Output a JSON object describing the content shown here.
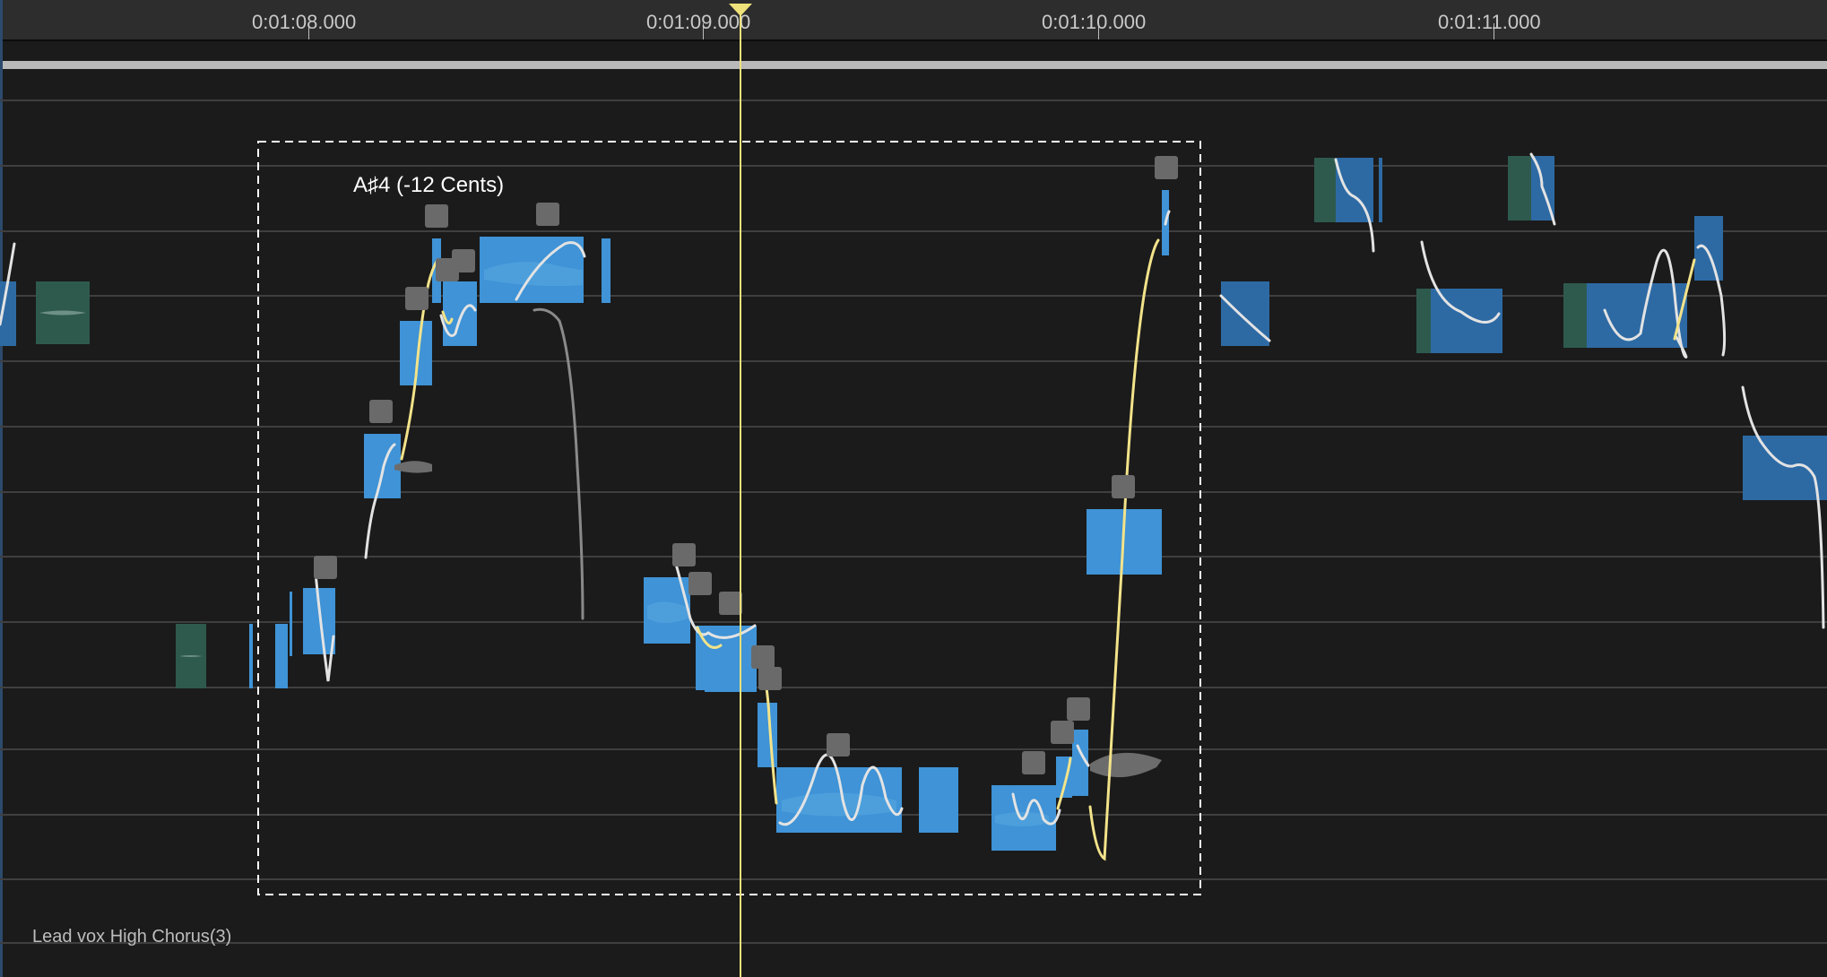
{
  "ruler": {
    "ticks": [
      {
        "label": "0:01:08.000",
        "time": 68.0
      },
      {
        "label": "0:01:09.000",
        "time": 69.0
      },
      {
        "label": "0:01:10.000",
        "time": 70.0
      },
      {
        "label": "0:01:11.000",
        "time": 71.0
      }
    ]
  },
  "playhead": {
    "time": 69.09
  },
  "selection": {
    "pitch_readout": "A♯4 (-12 Cents)"
  },
  "track": {
    "name": "Lead vox High Chorus(3)"
  },
  "colors": {
    "background": "#1b1b1b",
    "grid_line": "#3f3f3f",
    "note_blob": "#3f93d6",
    "note_blob_muted": "#2d6aa4",
    "note_blob_inactive": "#2e5a4e",
    "pitch_curve": "#e9e9e9",
    "pitch_curve_selected": "#f3e38a",
    "playhead": "#f0e27a",
    "handle": "#6a6a6a"
  }
}
